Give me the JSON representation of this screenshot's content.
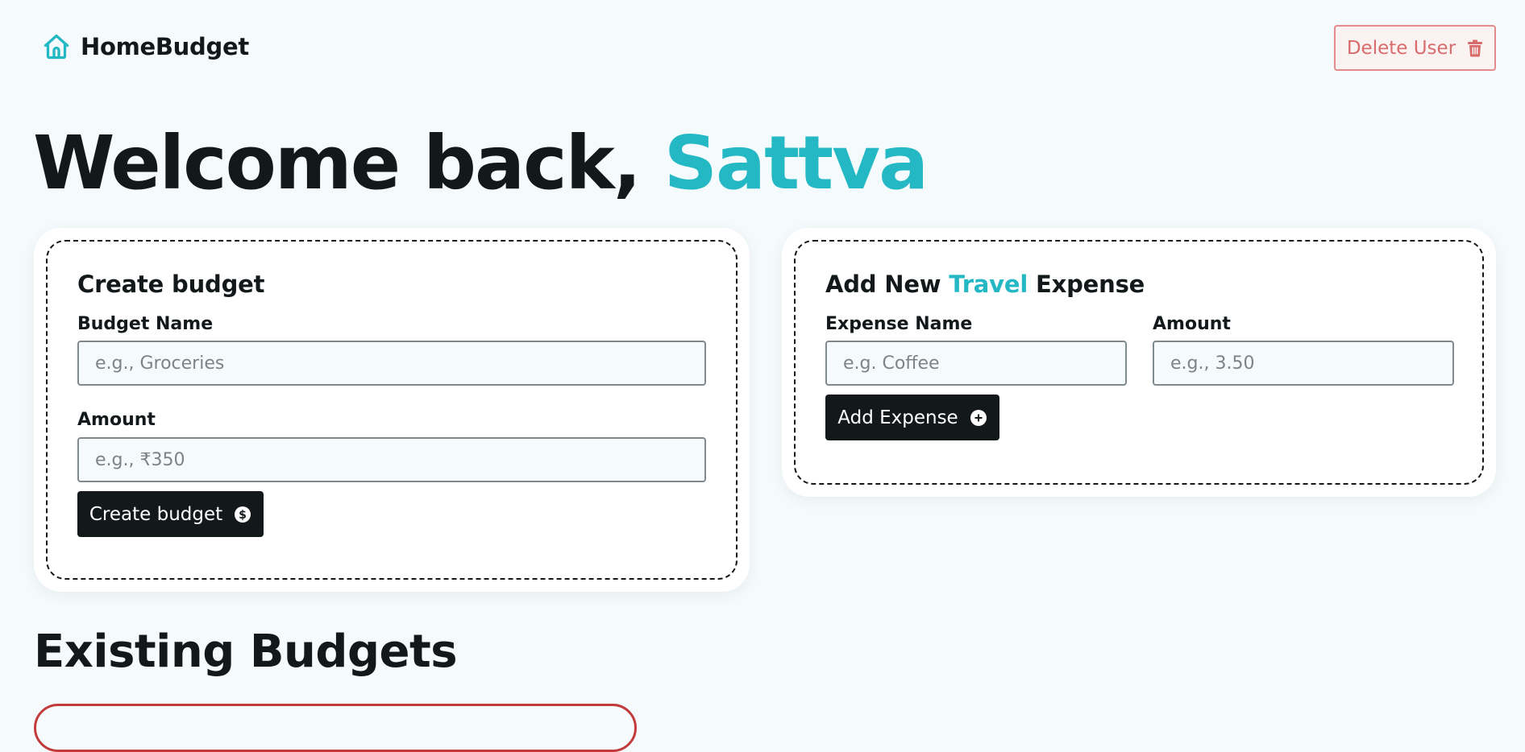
{
  "header": {
    "brand_name": "HomeBudget",
    "delete_user_label": "Delete User"
  },
  "welcome": {
    "prefix": "Welcome back, ",
    "user_name": "Sattva"
  },
  "create_budget": {
    "title": "Create budget",
    "budget_name_label": "Budget Name",
    "budget_name_placeholder": "e.g., Groceries",
    "amount_label": "Amount",
    "amount_placeholder": "e.g., ₹350",
    "submit_label": "Create budget"
  },
  "add_expense": {
    "title_prefix": "Add New ",
    "budget_name": "Travel",
    "title_suffix": " Expense",
    "expense_name_label": "Expense Name",
    "expense_name_placeholder": "e.g. Coffee",
    "amount_label": "Amount",
    "amount_placeholder": "e.g., 3.50",
    "submit_label": "Add Expense"
  },
  "existing_budgets": {
    "title": "Existing Budgets",
    "budget_card_color": "#c23b3b"
  },
  "theme": {
    "accent": "#23b8c4",
    "dark": "#13191b",
    "danger": "#d86b6b",
    "background": "#f5fafc"
  },
  "icons": {
    "brand": "house-icon",
    "delete": "trash-icon",
    "create_budget": "dollar-circle-icon",
    "add_expense": "plus-circle-icon"
  }
}
